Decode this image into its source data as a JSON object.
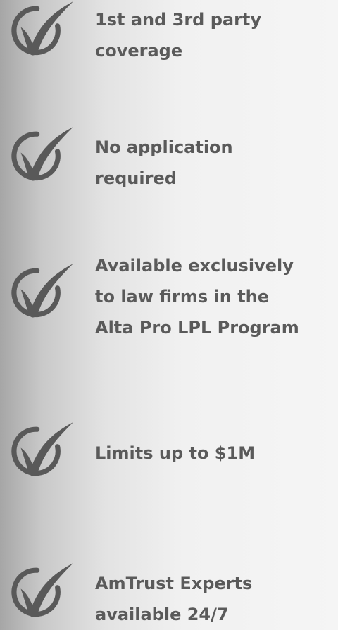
{
  "colors": {
    "text": "#5a5a5a",
    "icon": "#595959",
    "background_left": "#a6a6a6",
    "background_right": "#f5f5f5"
  },
  "features": [
    {
      "icon": "checkmark-circle-icon",
      "lines": [
        "1st and 3rd party",
        "coverage"
      ]
    },
    {
      "icon": "checkmark-circle-icon",
      "lines": [
        "No application",
        "required"
      ]
    },
    {
      "icon": "checkmark-circle-icon",
      "lines": [
        "Available exclusively",
        "to law firms in the",
        "Alta Pro LPL Program"
      ]
    },
    {
      "icon": "checkmark-circle-icon",
      "lines": [
        "Limits up to $1M"
      ]
    },
    {
      "icon": "checkmark-circle-icon",
      "lines": [
        "AmTrust Experts",
        "available 24/7"
      ]
    }
  ]
}
